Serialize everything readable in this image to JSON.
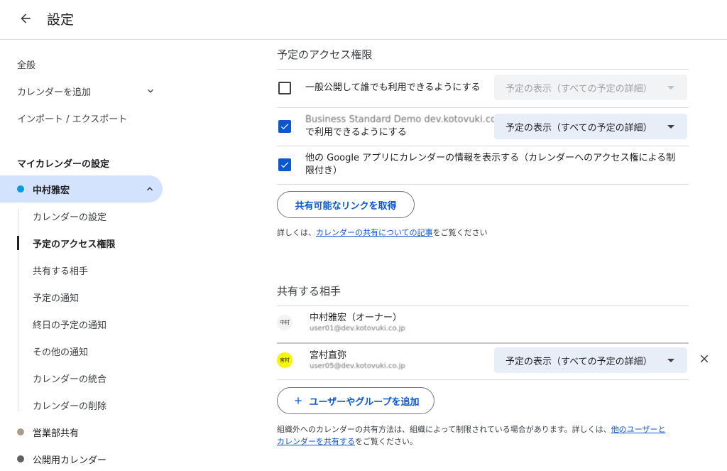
{
  "header": {
    "title": "設定"
  },
  "sidebar": {
    "general": "全般",
    "add_calendar": "カレンダーを追加",
    "import_export": "インポート / エクスポート",
    "my_calendars_title": "マイカレンダーの設定",
    "calendars": [
      {
        "name": "中村雅宏",
        "color": "#039be5"
      },
      {
        "name": "営業部共有",
        "color": "#a79b8e"
      },
      {
        "name": "公開用カレンダー",
        "color": "#616161"
      }
    ],
    "sub_items": [
      "カレンダーの設定",
      "予定のアクセス権限",
      "共有する相手",
      "予定の通知",
      "終日の予定の通知",
      "その他の通知",
      "カレンダーの統合",
      "カレンダーの削除"
    ]
  },
  "access": {
    "title": "予定のアクセス権限",
    "public_label": "一般公開して誰でも利用できるようにする",
    "public_select": "予定の表示（すべての予定の詳細）",
    "org_name": "Business Standard Demo dev.kotovuki.co.jp",
    "org_suffix": "で利用できるようにする",
    "org_select": "予定の表示（すべての予定の詳細）",
    "apps_label_1": "他の Google アプリにカレンダーの情報を表示する（カレンダーへのアクセス権による制",
    "apps_label_2": "限付き）",
    "share_link_button": "共有可能なリンクを取得",
    "help_prefix": "詳しくは、",
    "help_link": "カレンダーの共有についての記事",
    "help_suffix": "をご覧ください"
  },
  "share": {
    "title": "共有する相手",
    "people": [
      {
        "avatar": "中村",
        "avatar_color": "#f1f3f4",
        "name": "中村雅宏（オーナー）",
        "email": "user01@dev.kotovuki.co.jp"
      },
      {
        "avatar": "宮村",
        "avatar_color": "#f6f600",
        "name": "宮村直弥",
        "email": "user05@dev.kotovuki.co.jp",
        "permission": "予定の表示（すべての予定の詳細）"
      }
    ],
    "add_button": "ユーザーやグループを追加",
    "footer_text": "組織外へのカレンダーの共有方法は、組織によって制限されている場合があります。詳しくは、",
    "footer_link_1": "他のユーザーと",
    "footer_link_2": "カレンダーを共有する",
    "footer_suffix": "をご覧ください。"
  }
}
